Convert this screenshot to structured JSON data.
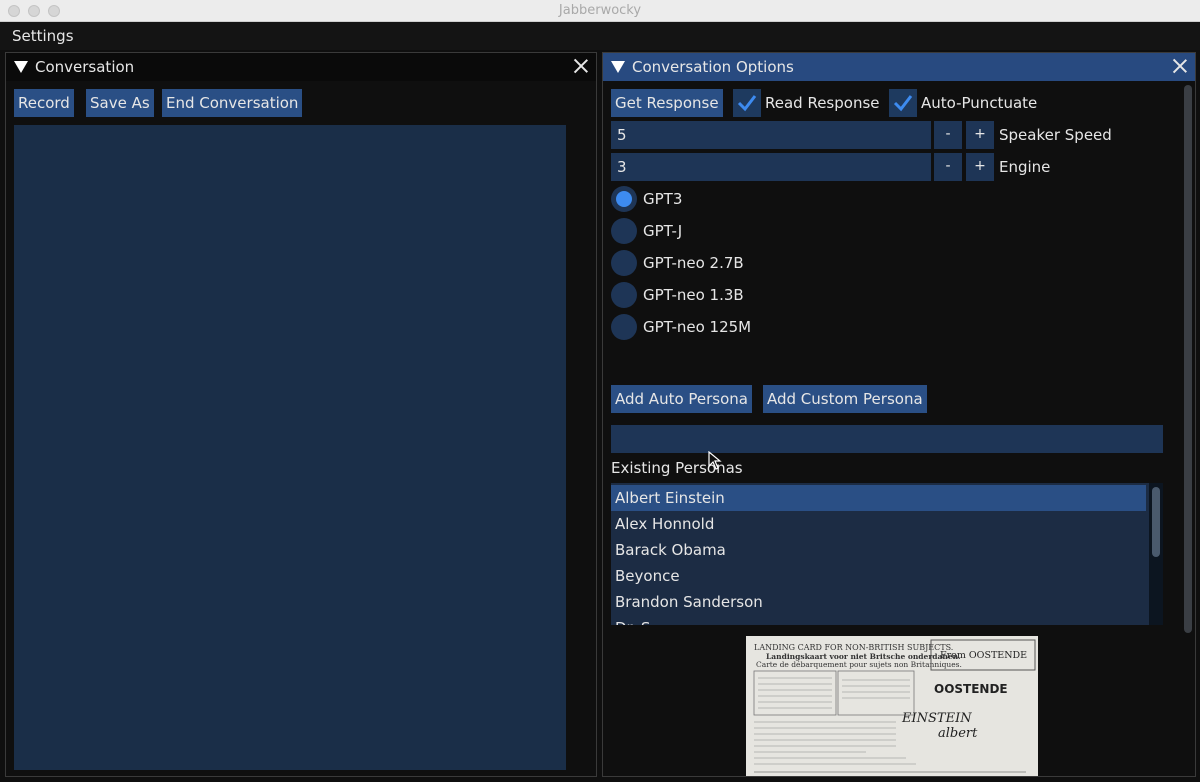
{
  "window": {
    "title": "Jabberwocky"
  },
  "menu": {
    "settings": "Settings"
  },
  "conversation_panel": {
    "title": "Conversation",
    "buttons": {
      "record": "Record",
      "save_as": "Save As",
      "end_conversation": "End Conversation"
    }
  },
  "options_panel": {
    "title": "Conversation Options",
    "get_response": "Get Response",
    "read_response": {
      "label": "Read Response",
      "checked": true
    },
    "auto_punctuate": {
      "label": "Auto-Punctuate",
      "checked": true
    },
    "speaker_speed": {
      "value": "5",
      "minus": "-",
      "plus": "+",
      "label": "Speaker Speed"
    },
    "engine": {
      "value": "3",
      "minus": "-",
      "plus": "+",
      "label": "Engine"
    },
    "models": [
      "GPT3",
      "GPT-J",
      "GPT-neo 2.7B",
      "GPT-neo 1.3B",
      "GPT-neo 125M"
    ],
    "selected_model": "GPT3",
    "add_auto_persona": "Add Auto Persona",
    "add_custom_persona": "Add Custom Persona",
    "persona_input_value": "",
    "existing_personas_label": "Existing Personas",
    "personas": [
      "Albert Einstein",
      "Alex Honnold",
      "Barack Obama",
      "Beyonce",
      "Brandon Sanderson",
      "Dr. S"
    ],
    "selected_persona": "Albert Einstein",
    "image_text": {
      "header": "LANDING CARD FOR NON-BRITISH SUBJECTS.",
      "header_nl": "Landingskaart voor niet Britsche onderdanen.",
      "header_fr": "Carte de débarquement pour sujets non Britanniques.",
      "from": "From OOSTENDE",
      "port": "OOSTENDE",
      "surname": "EINSTEIN",
      "name": "albert"
    }
  }
}
